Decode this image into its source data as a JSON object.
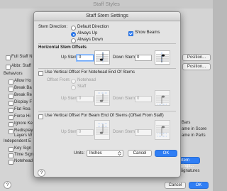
{
  "window": {
    "title": "Staff Styles"
  },
  "background": {
    "full_staff_label": "Full Staff N",
    "abbr_staff_label": "Abbr. Staff",
    "position_button": "Position...",
    "behaviors_heading": "Behaviors",
    "behavior_items": [
      "Allow Ho",
      "Break Ba",
      "Break Re",
      "Display F",
      "Flat Rea",
      "Force Hi",
      "Ignore Ke",
      "Redisplay",
      "Layers W"
    ],
    "independent_heading": "Independent E",
    "independent_items": [
      "Key Sign",
      "Time Sign",
      "Notehead"
    ],
    "right_items": [
      "Bars",
      "ame in Score",
      "ame in Parts"
    ],
    "bottom_checks": [
      {
        "label": "Key Signatures",
        "checked": true
      },
      {
        "label": "Lyrics",
        "checked": false
      },
      {
        "label": "Measure Numbers",
        "checked": false
      }
    ],
    "bottom_right_checks": [
      {
        "label": "Ties",
        "checked": false
      },
      {
        "label": "Time Signatures",
        "checked": false
      }
    ],
    "stem_settings_button": "Stem Settings...",
    "bottom_cancel": "Cancel",
    "bottom_ok": "OK",
    "help": "?"
  },
  "dialog": {
    "title": "Staff Stem Settings",
    "stem_direction_label": "Stem Direction:",
    "direction_options": [
      {
        "label": "Default Direction",
        "selected": false
      },
      {
        "label": "Always Up",
        "selected": true
      },
      {
        "label": "Always Down",
        "selected": false
      }
    ],
    "show_beams": {
      "label": "Show Beams",
      "checked": true
    },
    "horizontal_heading": "Horizontal Stem Offsets",
    "up_stem_label": "Up Stem:",
    "up_stem_value": "0",
    "down_stem_label": "Down Stem:",
    "down_stem_value": "0",
    "vertical_notehead": {
      "label": "Use Vertical Offset For Notehead End Of Stems",
      "checked": false
    },
    "offset_from_label": "Offset From:",
    "offset_from_options": [
      {
        "label": "Notehead",
        "selected": true
      },
      {
        "label": "Staff",
        "selected": false
      }
    ],
    "notehead_up_value": "0",
    "notehead_down_value": "0",
    "vertical_beam": {
      "label": "Use Vertical Offset For Beam End Of Stems (Offset From Staff)",
      "checked": false
    },
    "beam_up_value": "0",
    "beam_down_value": "0",
    "units_label": "Units:",
    "units_value": "Inches",
    "cancel_label": "Cancel",
    "ok_label": "OK",
    "help": "?"
  },
  "colors": {
    "accent": "#2f7ef5",
    "dialog_bg": "#e3e3e3",
    "window_bg": "#d4d4d4"
  }
}
